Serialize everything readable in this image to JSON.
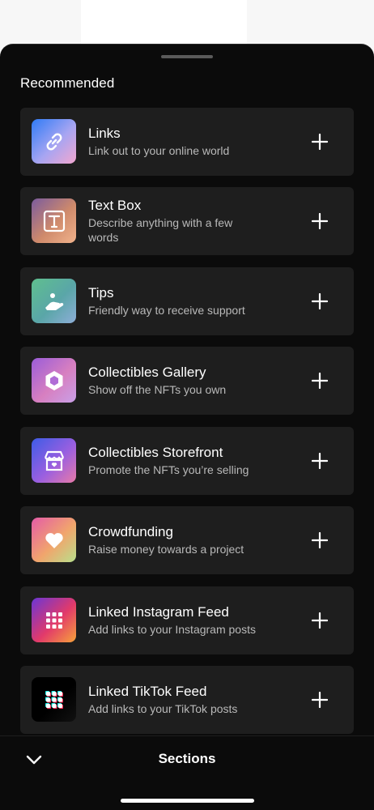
{
  "sheet": {
    "heading": "Recommended",
    "items": [
      {
        "title": "Links",
        "desc": "Link out to your online world",
        "icon": "link-icon",
        "gradient": [
          "#2f7bf6",
          "#a7a5f2",
          "#f3a6cf"
        ]
      },
      {
        "title": "Text Box",
        "desc": "Describe anything with a few words",
        "icon": "text-box-icon",
        "gradient": [
          "#7a5b9e",
          "#cf8a6b",
          "#f1b38c"
        ]
      },
      {
        "title": "Tips",
        "desc": "Friendly way to receive support",
        "icon": "hand-tip-icon",
        "gradient": [
          "#5fbf8e",
          "#5aa6a8",
          "#8eaed8"
        ]
      },
      {
        "title": "Collectibles Gallery",
        "desc": "Show off the NFTs you own",
        "icon": "hexagon-icon",
        "gradient": [
          "#9a5cd9",
          "#d77fc0",
          "#c9a0e8"
        ]
      },
      {
        "title": "Collectibles Storefront",
        "desc": "Promote the NFTs you’re selling",
        "icon": "storefront-icon",
        "gradient": [
          "#3d5ce6",
          "#9a5fe0",
          "#e87aa8"
        ]
      },
      {
        "title": "Crowdfunding",
        "desc": "Raise money towards a project",
        "icon": "heart-icon",
        "gradient": [
          "#e45ba8",
          "#f1a56c",
          "#b8e08c"
        ]
      },
      {
        "title": "Linked Instagram Feed",
        "desc": "Add links to your Instagram posts",
        "icon": "grid-icon",
        "gradient": [
          "#6a36d6",
          "#e23a6a",
          "#f7a33a"
        ]
      },
      {
        "title": "Linked TikTok Feed",
        "desc": "Add links to your TikTok posts",
        "icon": "tiktok-grid-icon",
        "gradient": [
          "#000000",
          "#000000",
          "#111111"
        ]
      }
    ]
  },
  "bottom": {
    "title": "Sections",
    "collapse_icon": "chevron-down-icon"
  }
}
